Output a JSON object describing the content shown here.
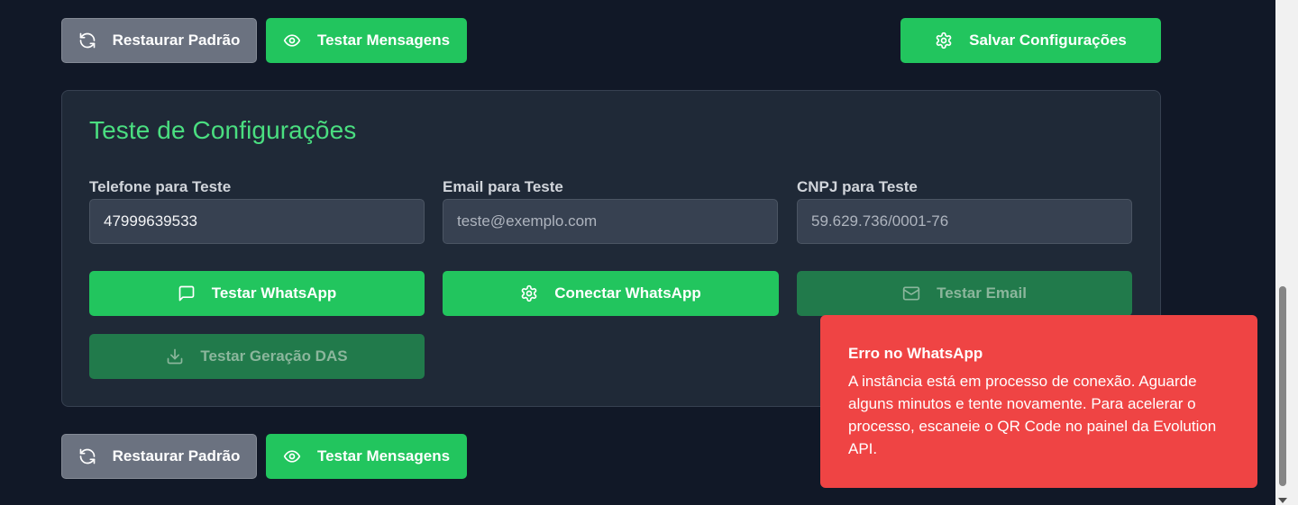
{
  "top_actions": {
    "restore_label": "Restaurar Padrão",
    "test_messages_label": "Testar Mensagens",
    "save_label": "Salvar Configurações"
  },
  "test_card": {
    "title": "Teste de Configurações",
    "phone": {
      "label": "Telefone para Teste",
      "value": "47999639533"
    },
    "email": {
      "label": "Email para Teste",
      "value": "teste@exemplo.com"
    },
    "cnpj": {
      "label": "CNPJ para Teste",
      "value": "59.629.736/0001-76"
    },
    "buttons": {
      "test_whatsapp": "Testar WhatsApp",
      "connect_whatsapp": "Conectar WhatsApp",
      "test_email": "Testar Email",
      "test_das": "Testar Geração DAS"
    }
  },
  "bottom_actions": {
    "restore_label": "Restaurar Padrão",
    "test_messages_label": "Testar Mensagens"
  },
  "toast": {
    "title": "Erro no WhatsApp",
    "message": "A instância está em processo de conexão. Aguarde alguns minutos e tente novamente. Para acelerar o processo, escaneie o QR Code no painel da Evolution API."
  },
  "colors": {
    "background": "#111827",
    "card": "#1f2937",
    "green": "#22c55e",
    "green_disabled": "#217a4b",
    "gray_button": "#6b7280",
    "title_green": "#4ade80",
    "error": "#ef4444"
  },
  "icons": {
    "restore": "refresh-icon",
    "test_messages": "eye-icon",
    "save": "gear-icon",
    "test_whatsapp": "message-square-icon",
    "connect_whatsapp": "gear-icon",
    "test_email": "mail-icon",
    "test_das": "download-icon"
  }
}
